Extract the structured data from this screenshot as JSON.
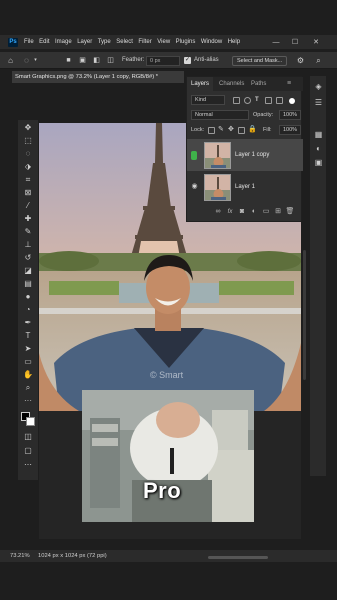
{
  "menu": {
    "app_badge": "Ps",
    "items": [
      "File",
      "Edit",
      "Image",
      "Layer",
      "Type",
      "Select",
      "Filter",
      "View",
      "Plugins",
      "Window",
      "Help"
    ],
    "minimize": "—",
    "maximize": "☐",
    "close": "✕"
  },
  "options": {
    "feather_label": "Feather:",
    "feather_value": "0 px",
    "antialias_label": "Anti-alias",
    "antialias_checked": "✓",
    "select_mask_label": "Select and Mask..."
  },
  "document": {
    "tab_title": "Smart Graphics.png @ 73.2% (Layer 1 copy, RGB/8#) *",
    "tab_close": "×"
  },
  "canvas": {
    "watermark": "© Smart",
    "meme_caption": "Pro"
  },
  "status": {
    "zoom": "73.21%",
    "doc_info": "1024 px x 1024 px (72 ppi)"
  },
  "layers_panel": {
    "tabs": [
      "Layers",
      "Channels",
      "Paths"
    ],
    "menu_icon": "≡",
    "filter_kind": "Kind",
    "blend_mode": "Normal",
    "opacity_label": "Opacity:",
    "opacity_value": "100%",
    "lock_label": "Lock:",
    "fill_label": "Fill:",
    "fill_value": "100%",
    "layers": [
      {
        "name": "Layer 1 copy",
        "visible": true,
        "selected": true
      },
      {
        "name": "Layer 1",
        "visible": true,
        "selected": false
      }
    ],
    "footer_icons": [
      "link-icon",
      "fx-icon",
      "mask-icon",
      "adjustment-icon",
      "group-icon",
      "new-layer-icon",
      "delete-icon"
    ]
  },
  "colors": {
    "app_bg": "#1e1e1e",
    "panel_bg": "#2f2f2f",
    "selected_layer": "#474747",
    "accent_green": "#3fb24a"
  }
}
